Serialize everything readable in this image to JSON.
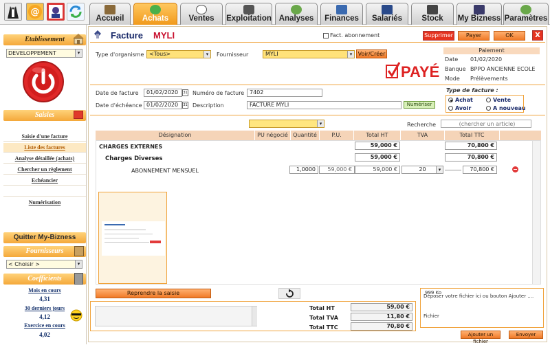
{
  "tabs": [
    {
      "label": "Accueil",
      "active": false
    },
    {
      "label": "Achats",
      "active": true
    },
    {
      "label": "Ventes",
      "active": false
    },
    {
      "label": "Exploitation",
      "active": false
    },
    {
      "label": "Analyses",
      "active": false
    },
    {
      "label": "Finances",
      "active": false
    },
    {
      "label": "Salariés",
      "active": false
    },
    {
      "label": "Stock",
      "active": false
    },
    {
      "label": "My Bizness",
      "active": false
    },
    {
      "label": "Paramètres",
      "active": false
    }
  ],
  "sidebar": {
    "etablissement_title": "Etablissement",
    "etablissement_value": "DEVELOPPEMENT",
    "saisies_title": "Saisies",
    "links": [
      {
        "label": "Saisie d'une facture",
        "selected": false
      },
      {
        "label": "Liste des factures",
        "selected": true
      },
      {
        "label": "Analyse détaillée (achats)",
        "selected": false
      },
      {
        "label": "Chercher un règlement",
        "selected": false
      },
      {
        "label": "Echéancier",
        "selected": false
      },
      {
        "label": "",
        "selected": false
      },
      {
        "label": "Numérisation",
        "selected": false
      }
    ],
    "quit_label": "Quitter My-Bizness",
    "fournisseurs_title": "Fournisseurs",
    "fournisseurs_select": "< Choisir >",
    "coefficients_title": "Coefficients",
    "stats": [
      {
        "label": "Mois en cours",
        "value": "4,31"
      },
      {
        "label": "30 derniers jours",
        "value": "4,12"
      },
      {
        "label": "Exercice en cours",
        "value": "4,02"
      }
    ]
  },
  "header": {
    "title": "Facture",
    "supplier": "MYLI",
    "abonnement_label": "Fact. abonnement",
    "abonnement_checked": false,
    "supprimer": "Supprimer",
    "payer": "Payer",
    "ok": "OK",
    "close": "X"
  },
  "form": {
    "type_org_label": "Type d'organisme",
    "type_org_value": "<Tous>",
    "fournisseur_label": "Fournisseur",
    "fournisseur_value": "MYLI",
    "voir_creer": "Voir/Créer",
    "paye_stamp": "PAYÉ",
    "date_facture_label": "Date de facture",
    "date_facture": "01/02/2020",
    "numero_label": "Numéro de facture",
    "numero": "7402",
    "date_echeance_label": "Date d'échéance",
    "date_echeance": "01/02/2020",
    "description_label": "Description",
    "description": "FACTURE MYLI",
    "numeriser": "Numériser"
  },
  "paiement": {
    "title": "Paiement",
    "date_label": "Date",
    "date": "01/02/2020",
    "banque_label": "Banque",
    "banque": "BPPO ANCIENNE ECOLE",
    "mode_label": "Mode",
    "mode": "Prélèvements"
  },
  "type_facture": {
    "title": "Type de facture :",
    "options": [
      {
        "label": "Achat",
        "checked": true
      },
      {
        "label": "Vente",
        "checked": false
      },
      {
        "label": "Avoir",
        "checked": false
      },
      {
        "label": "A nouveau",
        "checked": false
      }
    ]
  },
  "search": {
    "label": "Recherche",
    "placeholder": "(chercher un article)"
  },
  "table": {
    "headers": [
      "Désignation",
      "PU négocié",
      "Quantité",
      "P.U.",
      "Total HT",
      "TVA",
      "Total TTC"
    ],
    "groups": [
      {
        "name": "CHARGES EXTERNES",
        "total_ht": "59,000 €",
        "total_ttc": "70,800 €"
      },
      {
        "name": "Charges Diverses",
        "total_ht": "59,000 €",
        "total_ttc": "70,800 €"
      }
    ],
    "line": {
      "designation": "ABONNEMENT MENSUEL",
      "quantite": "1,0000",
      "pu": "59,000 €",
      "total_ht": "59,000 €",
      "tva": "20",
      "total_ttc": "70,800 €"
    }
  },
  "footer": {
    "reprendre": "Reprendre la saisie",
    "total_ht_label": "Total HT",
    "total_ht": "59,00 €",
    "total_tva_label": "Total TVA",
    "total_tva": "11,80 €",
    "total_ttc_label": "Total TTC",
    "total_ttc": "70,80 €",
    "upload_size": "999 Ko",
    "upload_hint": "Déposer votre fichier ici ou bouton Ajouter ....",
    "fichier_label": "Fichier",
    "ajouter": "Ajouter un fichier",
    "envoyer": "Envoyer"
  }
}
